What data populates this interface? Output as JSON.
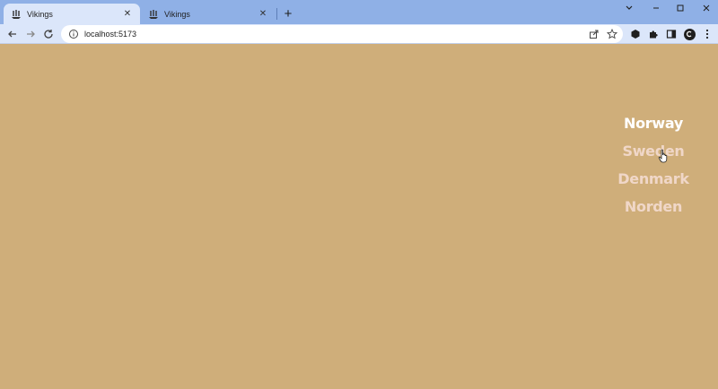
{
  "browser": {
    "tabs": [
      {
        "title": "Vikings",
        "active": true
      },
      {
        "title": "Vikings",
        "active": false
      }
    ],
    "new_tab_label": "+",
    "address": "localhost:5173"
  },
  "nav": {
    "items": [
      {
        "label": "Norway",
        "active": true
      },
      {
        "label": "Sweden",
        "active": false
      },
      {
        "label": "Denmark",
        "active": false
      },
      {
        "label": "Norden",
        "active": false
      }
    ]
  },
  "colors": {
    "page_background": "#cfae7a",
    "nav_active": "#ffffff",
    "nav_inactive": "#f0d7c8",
    "tabstrip": "#8fb0e6",
    "toolbar": "#dbe6fa"
  }
}
